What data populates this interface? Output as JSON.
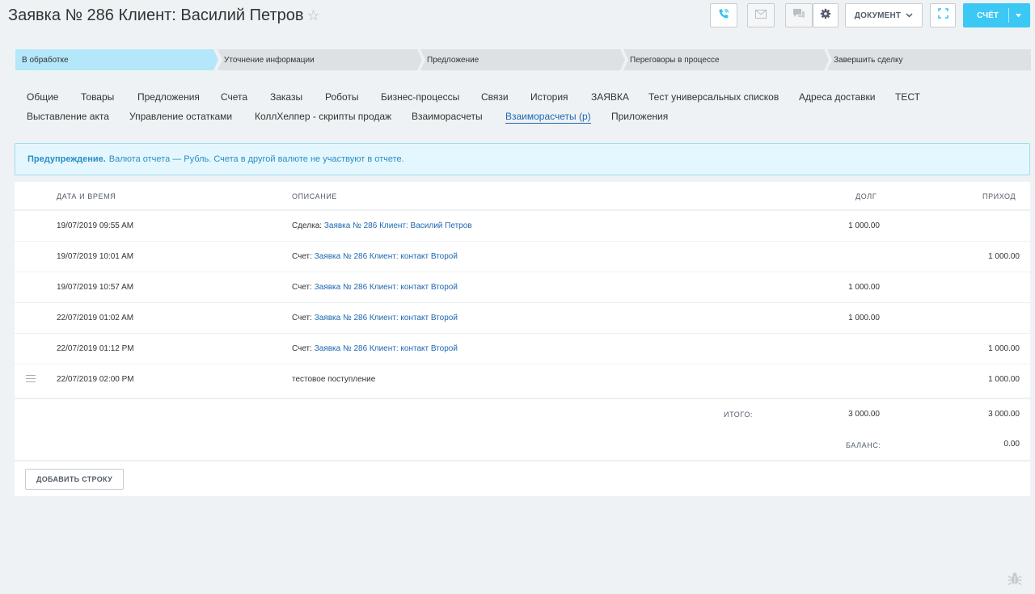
{
  "header": {
    "title": "Заявка № 286 Клиент: Василий Петров",
    "star": "☆",
    "document_button": "ДОКУМЕНТ",
    "invoice_button": "СЧЁТ"
  },
  "stages": [
    {
      "label": "В обработке"
    },
    {
      "label": "Уточнение информации"
    },
    {
      "label": "Предложение"
    },
    {
      "label": "Переговоры в процессе"
    },
    {
      "label": "Завершить сделку"
    }
  ],
  "tabs_row1": [
    "Общие",
    "Товары",
    "Предложения",
    "Счета",
    "Заказы",
    "Роботы",
    "Бизнес-процессы",
    "Связи",
    "История",
    "ЗАЯВКА",
    "Тест универсальных списков",
    "Адреса доставки",
    "ТЕСТ"
  ],
  "tabs_row2": [
    "Выставление акта",
    "Управление остатками",
    "КоллХелпер - скрипты продаж",
    "Взаиморасчеты",
    "Взаиморасчеты (р)",
    "Приложения"
  ],
  "active_tab": "Взаиморасчеты (р)",
  "alert": {
    "strong": "Предупреждение.",
    "text": "Валюта отчета — Рубль. Счета в другой валюте не участвуют в отчете."
  },
  "table": {
    "columns": {
      "date": "ДАТА И ВРЕМЯ",
      "description": "ОПИСАНИЕ",
      "debt": "ДОЛГ",
      "income": "ПРИХОД"
    },
    "rows": [
      {
        "date": "19/07/2019 09:55 AM",
        "prefix": "Сделка:",
        "link": "Заявка № 286 Клиент: Василий Петров",
        "debt": "1 000.00",
        "income": ""
      },
      {
        "date": "19/07/2019 10:01 AM",
        "prefix": "Счет:",
        "link": "Заявка № 286 Клиент: контакт Второй",
        "debt": "",
        "income": "1 000.00"
      },
      {
        "date": "19/07/2019 10:57 AM",
        "prefix": "Счет:",
        "link": "Заявка № 286 Клиент: контакт Второй",
        "debt": "1 000.00",
        "income": ""
      },
      {
        "date": "22/07/2019 01:02 AM",
        "prefix": "Счет:",
        "link": "Заявка № 286 Клиент: контакт Второй",
        "debt": "1 000.00",
        "income": ""
      },
      {
        "date": "22/07/2019 01:12 PM",
        "prefix": "Счет:",
        "link": "Заявка № 286 Клиент: контакт Второй",
        "debt": "",
        "income": "1 000.00"
      },
      {
        "date": "22/07/2019 02:00 PM",
        "prefix": "тестовое поступление",
        "link": "",
        "debt": "",
        "income": "1 000.00"
      }
    ],
    "total_label": "ИТОГО:",
    "total_debt": "3 000.00",
    "total_income": "3 000.00",
    "balance_label": "БАЛАНС:",
    "balance_value": "0.00",
    "add_row_button": "ДОБАВИТЬ СТРОКУ"
  },
  "colors": {
    "accent": "#3bc8f5",
    "link": "#2067b0",
    "stage_active": "#b4e7f9",
    "stage_inactive": "#dde1e4"
  }
}
